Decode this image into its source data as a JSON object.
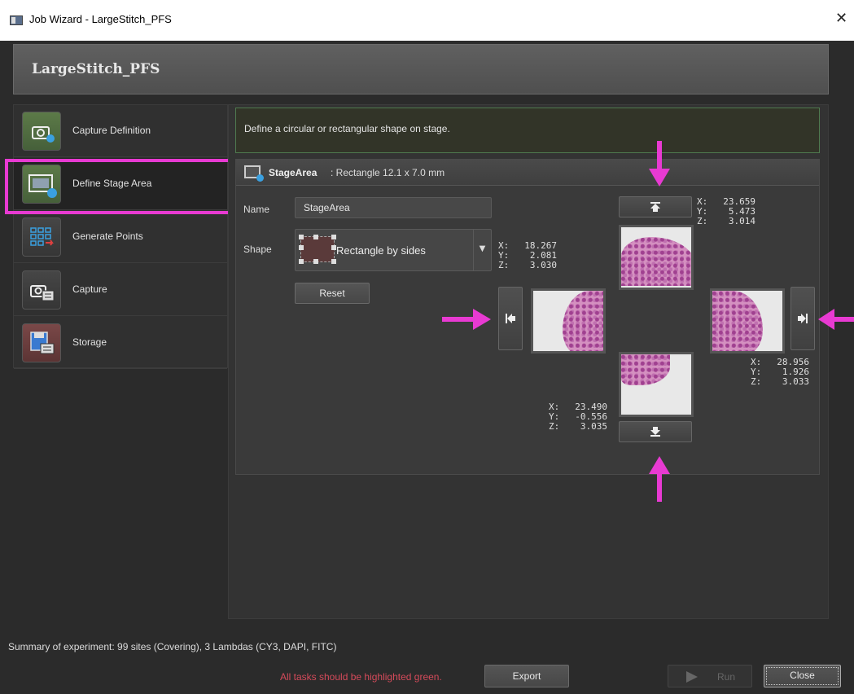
{
  "window": {
    "title": "Job Wizard - LargeStitch_PFS",
    "close_glyph": "✕"
  },
  "header": {
    "job_name": "LargeStitch_PFS"
  },
  "sidebar": {
    "items": [
      {
        "label": "Capture Definition",
        "icon": "camera-gear-icon",
        "status_color": "#5c7a48"
      },
      {
        "label": "Define Stage Area",
        "icon": "stage-area-icon",
        "status_color": "#5c7a48",
        "selected": true
      },
      {
        "label": "Generate Points",
        "icon": "grid-points-icon",
        "status_color": "#464646"
      },
      {
        "label": "Capture",
        "icon": "camera-list-icon",
        "status_color": "#464646"
      },
      {
        "label": "Storage",
        "icon": "floppy-disk-icon",
        "status_color": "#7a4848"
      }
    ]
  },
  "description": "Define a circular or rectangular shape on stage.",
  "stage_area": {
    "name": "StageArea",
    "desc": ": Rectangle  12.1 x 7.0 mm",
    "name_label": "Name",
    "name_value": "StageArea",
    "shape_label": "Shape",
    "shape_value": "Rectangle by sides",
    "reset_label": "Reset",
    "coords": {
      "top": {
        "x": "23.659",
        "y": "5.473",
        "z": "3.014"
      },
      "left": {
        "x": "18.267",
        "y": "2.081",
        "z": "3.030"
      },
      "right": {
        "x": "28.956",
        "y": "1.926",
        "z": "3.033"
      },
      "bottom": {
        "x": "23.490",
        "y": "-0.556",
        "z": "3.035"
      }
    },
    "axis_labels": {
      "x": "X:",
      "y": "Y:",
      "z": "Z:"
    }
  },
  "footer": {
    "summary": "Summary of experiment: 99 sites (Covering), 3 Lambdas (CY3, DAPI, FITC)",
    "warning": "All tasks should be highlighted green.",
    "export_label": "Export",
    "run_label": "Run",
    "close_label": "Close"
  },
  "colors": {
    "annotation_magenta": "#e83ad2",
    "warning_red": "#d44a5a",
    "desc_border_green": "#4f7a4f"
  }
}
